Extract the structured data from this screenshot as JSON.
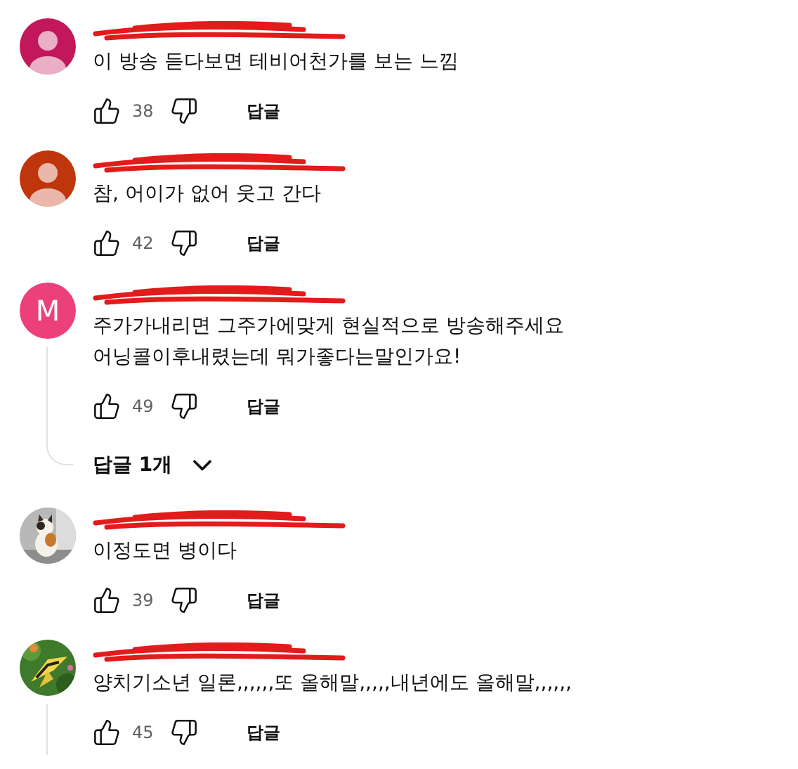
{
  "comments": [
    {
      "avatar": {
        "kind": "default",
        "color": "#c2185b"
      },
      "text": "이 방송 듣다보면 테비어천가를 보는 느낌",
      "likes": "38",
      "reply_label": "답글",
      "thread_line": false
    },
    {
      "avatar": {
        "kind": "default",
        "color": "#bf360c"
      },
      "text": "참, 어이가 없어 웃고 간다",
      "likes": "42",
      "reply_label": "답글",
      "thread_line": false
    },
    {
      "avatar": {
        "kind": "letter",
        "color": "#ec407a",
        "letter": "M"
      },
      "text": "주가가내리면 그주가에맞게 현실적으로 방송해주세요\n어닝콜이후내렸는데 뭐가좋다는말인가요!",
      "likes": "49",
      "reply_label": "답글",
      "thread_line": true,
      "replies_toggle": {
        "label": "답글 1개"
      }
    },
    {
      "text": "이정도면 병이다",
      "likes": "39",
      "reply_label": "답글",
      "thread_line": false
    },
    {
      "text": "양치기소년 일론,,,,,,또 올해말,,,,,내년에도 올해말,,,,,,",
      "likes": "45",
      "reply_label": "답글",
      "thread_line": true
    }
  ]
}
